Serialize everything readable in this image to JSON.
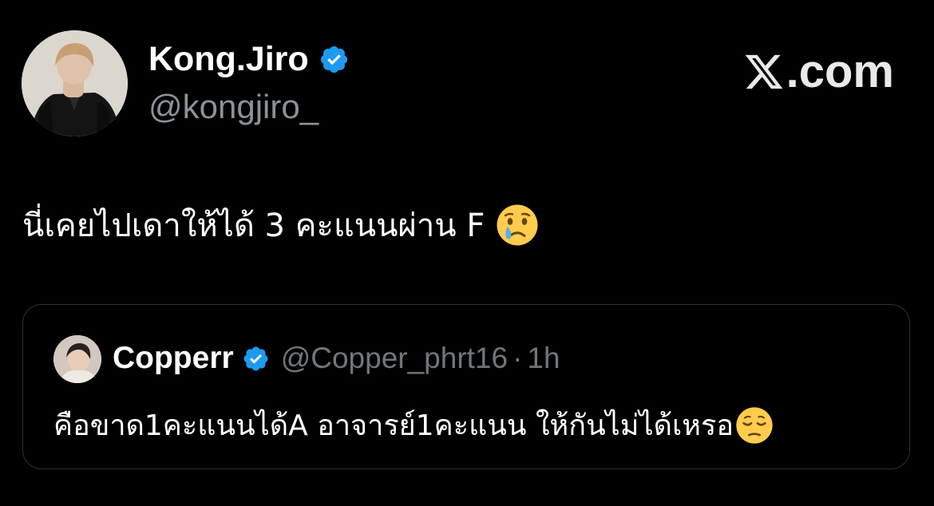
{
  "tweet": {
    "author": {
      "display_name": "Kong.Jiro",
      "handle": "@kongjiro_",
      "verified_icon": "verified-badge-icon"
    },
    "text": "นี่เคยไปเดาให้ได้ 3 คะแนนผ่าน F",
    "emoji": "crying-face-emoji"
  },
  "brand": {
    "logo_icon": "x-logo-icon",
    "label": ".com"
  },
  "quoted_tweet": {
    "author": {
      "display_name": "Copperr",
      "handle": "@Copper_phrt16",
      "separator": "·",
      "time": "1h",
      "verified_icon": "verified-badge-icon"
    },
    "text": "คือขาด1คะแนนได้A อาจารย์1คะแนน ให้กันไม่ได้เหรอ",
    "emoji": "pensive-face-emoji"
  },
  "colors": {
    "background": "#000000",
    "primary_text": "#ffffff",
    "secondary_text": "#71767b",
    "verified": "#1d9bf0",
    "border": "#2f3336"
  }
}
